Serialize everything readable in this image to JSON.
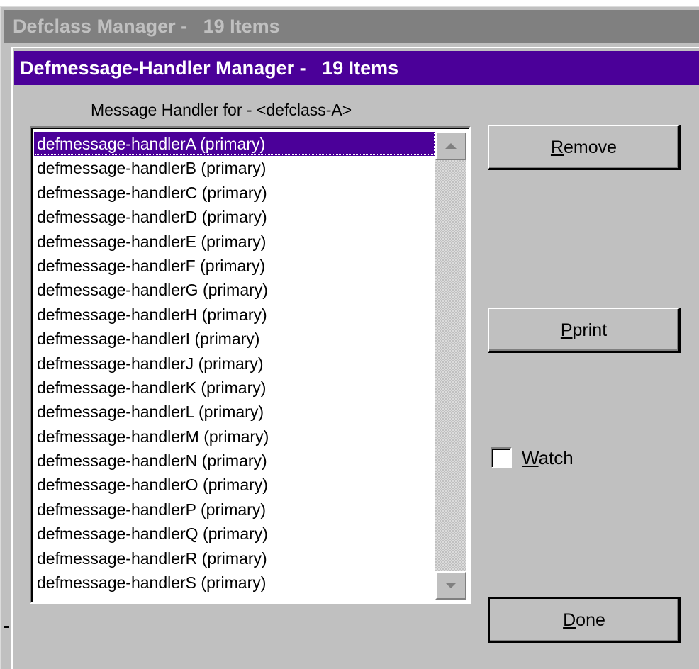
{
  "background_window": {
    "title": "Defclass Manager -   19 Items"
  },
  "dialog": {
    "title": "Defmessage-Handler Manager -   19 Items",
    "list_label": "Message Handler for - <defclass-A>",
    "selected_index": 0,
    "items": [
      "defmessage-handlerA (primary)",
      "defmessage-handlerB (primary)",
      "defmessage-handlerC (primary)",
      "defmessage-handlerD (primary)",
      "defmessage-handlerE (primary)",
      "defmessage-handlerF (primary)",
      "defmessage-handlerG (primary)",
      "defmessage-handlerH (primary)",
      "defmessage-handlerI (primary)",
      "defmessage-handlerJ (primary)",
      "defmessage-handlerK (primary)",
      "defmessage-handlerL (primary)",
      "defmessage-handlerM (primary)",
      "defmessage-handlerN (primary)",
      "defmessage-handlerO (primary)",
      "defmessage-handlerP (primary)",
      "defmessage-handlerQ (primary)",
      "defmessage-handlerR (primary)",
      "defmessage-handlerS (primary)"
    ],
    "buttons": {
      "remove": {
        "accel": "R",
        "rest": "emove"
      },
      "pprint": {
        "accel": "P",
        "rest": "print"
      },
      "done": {
        "accel": "D",
        "rest": "one"
      }
    },
    "watch": {
      "accel": "W",
      "rest": "atch",
      "checked": false
    }
  },
  "colors": {
    "active_title": "#4b0099",
    "inactive_title": "#808080",
    "face": "#c0c0c0",
    "selection": "#4b0099"
  }
}
